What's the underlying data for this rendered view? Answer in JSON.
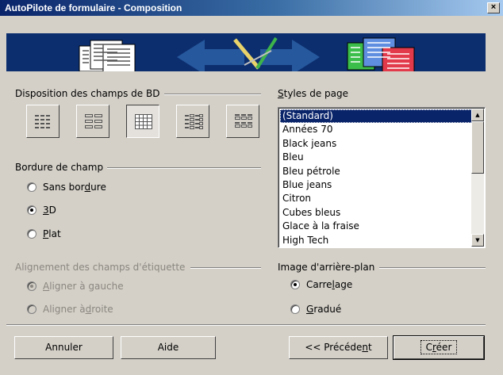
{
  "window": {
    "title": "AutoPilote de formulaire - Composition",
    "close_glyph": "×"
  },
  "layout": {
    "label": "Disposition des champs de BD",
    "options": [
      {
        "id": "columnar-left",
        "icon": "columns-left-label-icon",
        "pressed": false
      },
      {
        "id": "columnar-top",
        "icon": "columns-top-label-icon",
        "pressed": false
      },
      {
        "id": "datasheet",
        "icon": "table-grid-icon",
        "pressed": true
      },
      {
        "id": "block-left",
        "icon": "block-left-label-icon",
        "pressed": false
      },
      {
        "id": "block-top",
        "icon": "block-top-label-icon",
        "pressed": false
      }
    ]
  },
  "border": {
    "label": "Bordure de champ",
    "options": [
      {
        "pre": "Sans bor",
        "key": "d",
        "post": "ure",
        "checked": false
      },
      {
        "pre": "",
        "key": "3",
        "post": "D",
        "checked": true
      },
      {
        "pre": "",
        "key": "P",
        "post": "lat",
        "checked": false
      }
    ]
  },
  "label_alignment": {
    "label": "Alignement des champs d'étiquette",
    "options": [
      {
        "pre": "",
        "key": "A",
        "post": "ligner à gauche",
        "checked": true
      },
      {
        "pre": "Aligner à ",
        "key": "d",
        "post": "roite",
        "checked": false
      }
    ]
  },
  "page_styles": {
    "label_key": "S",
    "label_rest": "tyles de page",
    "items": [
      "(Standard)",
      "Années 70",
      "Black jeans",
      "Bleu",
      "Bleu pétrole",
      "Blue jeans",
      "Citron",
      "Cubes bleus",
      "Glace à la fraise",
      "High Tech"
    ],
    "selected": "(Standard)",
    "scroll_up_glyph": "▲",
    "scroll_down_glyph": "▼"
  },
  "background": {
    "label": "Image d'arrière-plan",
    "options": [
      {
        "pre": "Carre",
        "key": "l",
        "post": "age",
        "checked": true
      },
      {
        "pre": "",
        "key": "G",
        "post": "radué",
        "checked": false
      }
    ]
  },
  "buttons": {
    "cancel": "Annuler",
    "help": "Aide",
    "back_pre": "<< Précéde",
    "back_key": "n",
    "back_post": "t",
    "create_pre": "C",
    "create_key": "r",
    "create_post": "éer"
  },
  "colors": {
    "title_start": "#0a246a",
    "title_end": "#a6caf0",
    "banner": "#0c2e6e",
    "selection": "#0a246a",
    "face": "#d4d0c8"
  }
}
